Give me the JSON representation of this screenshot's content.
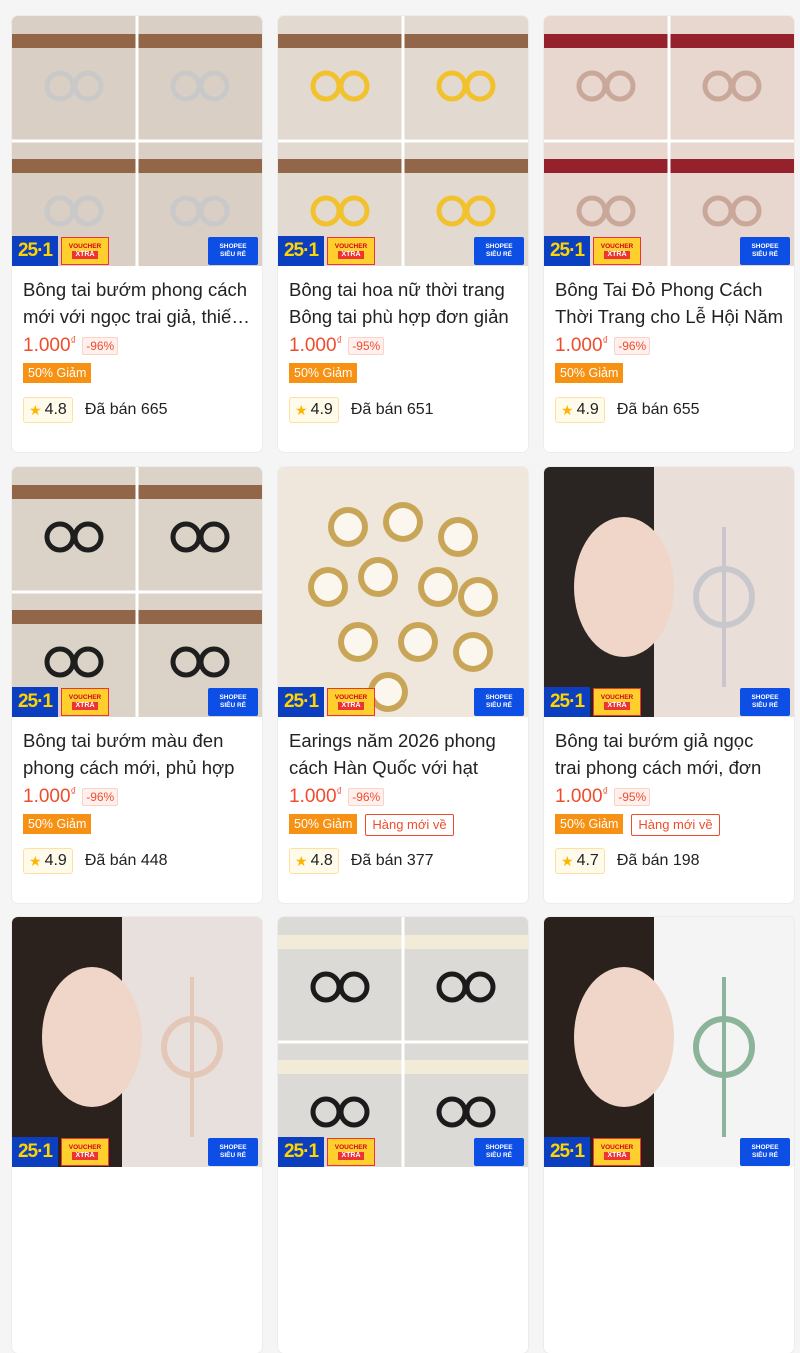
{
  "promo": {
    "sale": "25·1",
    "voucher_top": "VOUCHER",
    "voucher_bottom": "XTRA",
    "shopee_top": "SHOPEE",
    "shopee_bottom": "SIÊU RẺ"
  },
  "currency": "₫",
  "products": [
    {
      "title": "Bông tai bướm phong cách mới với ngọc trai giả, thiết kế",
      "price": "1.000",
      "discount": "-96%",
      "tag": "50% Giảm",
      "tag2": "",
      "rating": "4.8",
      "sold": "Đã bán 665",
      "palette": [
        "#d9cfc4",
        "#8a5a3a",
        "#c9c9c9"
      ]
    },
    {
      "title": "Bông tai hoa nữ thời trang Bông tai phù hợp đơn giản",
      "price": "1.000",
      "discount": "-95%",
      "tag": "50% Giảm",
      "tag2": "",
      "rating": "4.9",
      "sold": "Đã bán 651",
      "palette": [
        "#e2dad0",
        "#8a5a3a",
        "#f2c22e"
      ]
    },
    {
      "title": "Bông Tai Đỏ Phong Cách Thời Trang cho Lễ Hội Năm",
      "price": "1.000",
      "discount": "-96%",
      "tag": "50% Giảm",
      "tag2": "",
      "rating": "4.9",
      "sold": "Đã bán 655",
      "palette": [
        "#e7d7cf",
        "#8b0d18",
        "#c9a89a"
      ]
    },
    {
      "title": "Bông tai bướm màu đen phong cách mới, phủ hợp",
      "price": "1.000",
      "discount": "-96%",
      "tag": "50% Giảm",
      "tag2": "",
      "rating": "4.9",
      "sold": "Đã bán 448",
      "palette": [
        "#dcd3c8",
        "#8a5a3a",
        "#1e1e1e"
      ]
    },
    {
      "title": "Earings năm 2026 phong cách Hàn Quốc với hạt",
      "price": "1.000",
      "discount": "-96%",
      "tag": "50% Giảm",
      "tag2": "Hàng mới về",
      "rating": "4.8",
      "sold": "Đã bán 377",
      "palette": [
        "#efe7dc",
        "#c9a657",
        "#fbf6ee"
      ]
    },
    {
      "title": "Bông tai bướm giả ngọc trai phong cách mới, đơn",
      "price": "1.000",
      "discount": "-95%",
      "tag": "50% Giảm",
      "tag2": "Hàng mới về",
      "rating": "4.7",
      "sold": "Đã bán 198",
      "palette": [
        "#e9dfd8",
        "#2a2522",
        "#c8c8cc"
      ]
    },
    {
      "title": "",
      "price": "",
      "discount": "",
      "tag": "",
      "tag2": "",
      "rating": "",
      "sold": "",
      "palette": [
        "#e8e0dc",
        "#2b211d",
        "#e3c8b8"
      ]
    },
    {
      "title": "",
      "price": "",
      "discount": "",
      "tag": "",
      "tag2": "",
      "rating": "",
      "sold": "",
      "palette": [
        "#dcdad6",
        "#f3ecd8",
        "#1b1b1b"
      ]
    },
    {
      "title": "",
      "price": "",
      "discount": "",
      "tag": "",
      "tag2": "",
      "rating": "",
      "sold": "",
      "palette": [
        "#f4f4f4",
        "#2a211c",
        "#8bb49b"
      ]
    }
  ]
}
